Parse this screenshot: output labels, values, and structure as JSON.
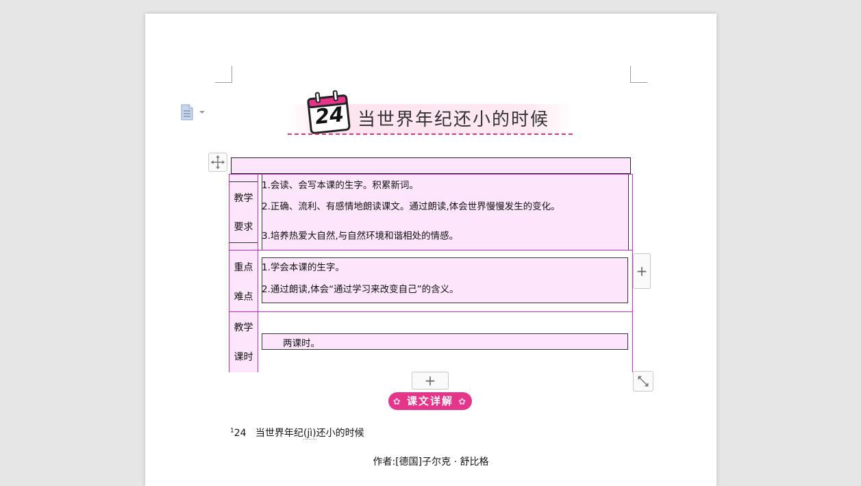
{
  "lesson": {
    "number": "24",
    "title": "当世界年纪还小的时候"
  },
  "table": {
    "rows": [
      {
        "label_line1": "教学",
        "label_line2": "要求",
        "items": [
          "1.会读、会写本课的生字。积累新词。",
          "2.正确、流利、有感情地朗读课文。通过朗读,体会世界慢慢发生的变化。",
          "3.培养热爱大自然,与自然环境和谐相处的情感。"
        ]
      },
      {
        "label_line1": "重点",
        "label_line2": "难点",
        "items": [
          "1.学会本课的生字。",
          "2.通过朗读,体会“通过学习来改变自己”的含义。"
        ]
      },
      {
        "label_line1": "教学",
        "label_line2": "课时",
        "items": [
          "两课时。"
        ]
      }
    ]
  },
  "section": {
    "heading": "课文详解"
  },
  "body": {
    "superscript": "1",
    "lesson_number": "24",
    "title_before": "当世界年纪",
    "pinyin": "(jì)",
    "title_after": "还小的时候",
    "author": "作者:[德国]子尔克 · 舒比格"
  },
  "controls": {
    "add_symbol": "+"
  },
  "colors": {
    "accent": "#e5358a",
    "cell_fill": "#fde6fb",
    "table_border": "#c72fd0"
  }
}
